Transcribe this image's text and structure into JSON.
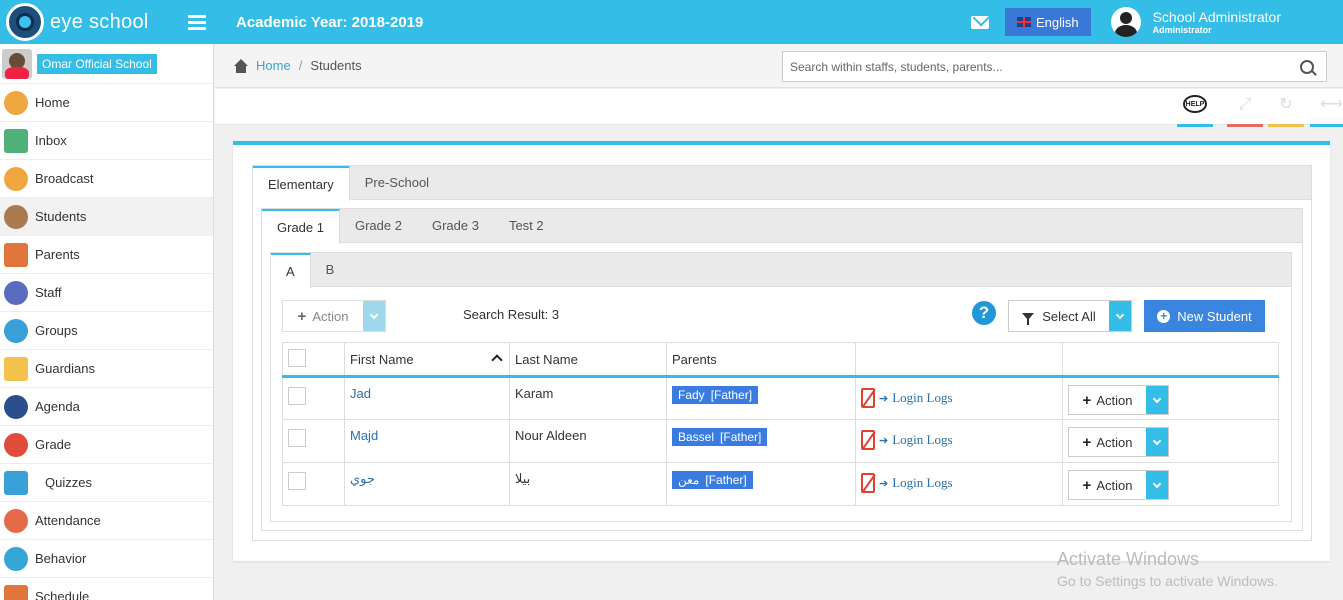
{
  "header": {
    "app_name": "eye school",
    "academic_year": "Academic Year: 2018-2019",
    "language": "English",
    "user_name": "School Administrator",
    "user_role": "Administrator",
    "accent_color": "#34bde6"
  },
  "sidebar": {
    "school_name": "Omar Official School",
    "items": [
      {
        "label": "Home",
        "icon": "home-icon",
        "color": "#f0a640"
      },
      {
        "label": "Inbox",
        "icon": "inbox-icon",
        "color": "#4fb07a"
      },
      {
        "label": "Broadcast",
        "icon": "broadcast-icon",
        "color": "#f0a640"
      },
      {
        "label": "Students",
        "icon": "students-icon",
        "color": "#a97a4e"
      },
      {
        "label": "Parents",
        "icon": "parents-icon",
        "color": "#e0763b"
      },
      {
        "label": "Staff",
        "icon": "staff-icon",
        "color": "#5a6cc0"
      },
      {
        "label": "Groups",
        "icon": "groups-icon",
        "color": "#3aa0d8"
      },
      {
        "label": "Guardians",
        "icon": "guardians-icon",
        "color": "#f3c24a"
      },
      {
        "label": "Agenda",
        "icon": "agenda-icon",
        "color": "#2b4f8c"
      },
      {
        "label": "Grade",
        "icon": "grade-icon",
        "color": "#e04b3b"
      },
      {
        "label": "Quizzes",
        "icon": "quizzes-icon",
        "color": "#3aa0d8"
      },
      {
        "label": "Attendance",
        "icon": "attendance-icon",
        "color": "#e56a4a"
      },
      {
        "label": "Behavior",
        "icon": "behavior-icon",
        "color": "#34a6d6"
      },
      {
        "label": "Schedule",
        "icon": "schedule-icon",
        "color": "#e0763b"
      }
    ]
  },
  "breadcrumb": {
    "home": "Home",
    "separator": "/",
    "current": "Students"
  },
  "search": {
    "placeholder": "Search within staffs, students, parents..."
  },
  "toolbar": {
    "help_label": "HELP",
    "bar_colors": [
      "#34bde6",
      "#e86a5e",
      "#f3c24a",
      "#34bde6"
    ]
  },
  "tabs": {
    "level1": [
      "Elementary",
      "Pre-School"
    ],
    "level2": [
      "Grade 1",
      "Grade 2",
      "Grade 3",
      "Test 2"
    ],
    "level3": [
      "A",
      "B"
    ]
  },
  "controls": {
    "action_label": "Action",
    "search_result": "Search Result: 3",
    "help_mark": "?",
    "select_all": "Select All",
    "new_student": "New Student"
  },
  "table": {
    "columns": [
      "First Name",
      "Last Name",
      "Parents",
      "",
      ""
    ],
    "login_logs_label": "Login Logs",
    "row_action_label": "Action",
    "rows": [
      {
        "first_name": "Jad",
        "last_name": "Karam",
        "parent_name": "Fady",
        "parent_rel": "[Father]"
      },
      {
        "first_name": "Majd",
        "last_name": "Nour Aldeen",
        "parent_name": "Bassel",
        "parent_rel": "[Father]"
      },
      {
        "first_name": "جوي",
        "last_name": "بيلا",
        "parent_name": "معن",
        "parent_rel": "[Father]"
      }
    ]
  },
  "watermark": {
    "line1": "Activate Windows",
    "line2": "Go to Settings to activate Windows."
  }
}
